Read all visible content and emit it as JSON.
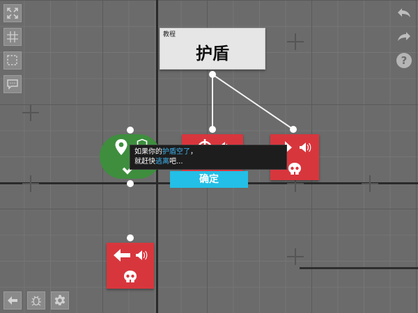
{
  "title_card": {
    "caption": "教程",
    "title": "护盾"
  },
  "tooltip": {
    "line1_pre": "如果你的",
    "line1_highlight": "护盾空了",
    "line1_post": "，",
    "line2_pre": "就赶快",
    "line2_highlight": "逃离",
    "line2_post": "吧..."
  },
  "confirm_label": "确定",
  "colors": {
    "node_red": "#d8363d",
    "node_green": "#3e8e3e",
    "highlight": "#3fb6f2",
    "confirm_bg": "#23bfe6"
  },
  "icons": {
    "left_toolbar": [
      "fullscreen-icon",
      "grid-icon",
      "select-box-icon",
      "comment-icon"
    ],
    "right_toolbar": [
      "undo-icon",
      "redo-icon",
      "help-icon"
    ],
    "bottom_toolbar": [
      "back-arrow-icon",
      "debug-bug-icon",
      "settings-gear-icon"
    ],
    "nodes": [
      "location-pin-icon",
      "shield-icon",
      "checkmark-icon",
      "crosshair-icon",
      "arrow-right-icon",
      "arrow-left-icon",
      "speaker-icon",
      "skull-icon"
    ]
  }
}
